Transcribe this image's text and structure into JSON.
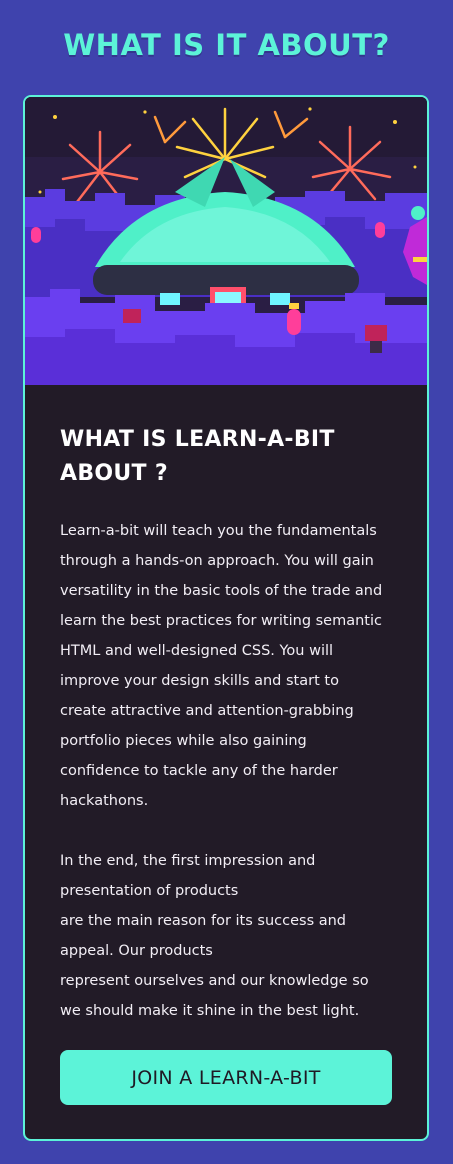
{
  "section": {
    "title": "WHAT IS IT ABOUT?"
  },
  "card": {
    "heading": "WHAT IS LEARN-A-BIT ABOUT ?",
    "paragraph1_lines": [
      "Learn-a-bit will teach you the fundamentals",
      "through a hands-on approach. You will gain",
      "versatility in the basic tools of the trade and",
      "learn the best practices for writing semantic",
      "HTML and well-designed CSS. You will",
      "improve your design skills and start to",
      "create attractive and attention-grabbing",
      "portfolio pieces while also gaining",
      "confidence to tackle any of the harder",
      "hackathons."
    ],
    "paragraph2_lines": [
      "In the end, the first impression and",
      "presentation of products",
      "are the main reason for its success and",
      "appeal. Our products",
      "represent ourselves and our knowledge so",
      "we should make it shine in the best light."
    ],
    "cta_label": "JOIN A LEARN-A-BIT"
  },
  "colors": {
    "page_background": "#3f43ad",
    "accent": "#5cf3d8",
    "card_background": "#221b27",
    "text": "#f2eef5"
  },
  "hero_image": {
    "icon": "festival-illustration"
  }
}
